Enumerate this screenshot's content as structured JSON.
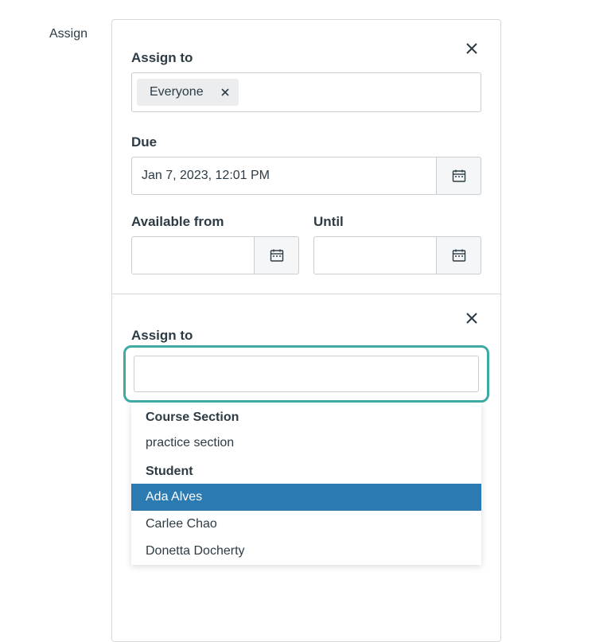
{
  "leftLabel": "Assign",
  "card1": {
    "assignTo": {
      "label": "Assign to",
      "pill": "Everyone"
    },
    "due": {
      "label": "Due",
      "value": "Jan 7, 2023, 12:01 PM"
    },
    "availableFrom": {
      "label": "Available from",
      "value": ""
    },
    "until": {
      "label": "Until",
      "value": ""
    }
  },
  "card2": {
    "assignTo": {
      "label": "Assign to"
    },
    "dropdown": {
      "groups": [
        {
          "header": "Course Section",
          "options": [
            {
              "label": "practice section",
              "highlighted": false
            }
          ]
        },
        {
          "header": "Student",
          "options": [
            {
              "label": "Ada Alves",
              "highlighted": true
            },
            {
              "label": "Carlee Chao",
              "highlighted": false
            },
            {
              "label": "Donetta Docherty",
              "highlighted": false
            }
          ]
        }
      ]
    }
  }
}
